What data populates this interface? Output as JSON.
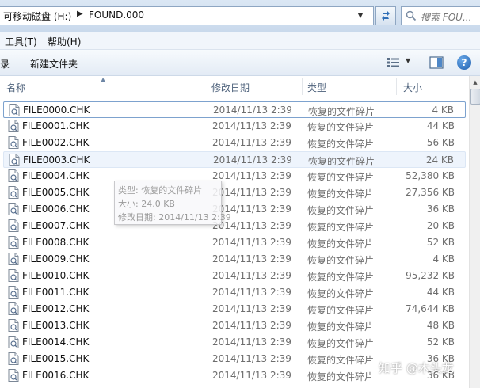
{
  "address": {
    "crumbs": [
      "可移动磁盘 (H:)",
      "FOUND.000"
    ],
    "search_placeholder": "搜索 FOU..."
  },
  "menu": [
    "工具(T)",
    "帮助(H)"
  ],
  "command_bar": {
    "partial_left": "录",
    "new_folder": "新建文件夹"
  },
  "columns": {
    "name": "名称",
    "modified": "修改日期",
    "type": "类型",
    "size": "大小"
  },
  "files": [
    {
      "name": "FILE0000.CHK",
      "date": "2014/11/13 2:39",
      "type": "恢复的文件碎片",
      "size": "4 KB"
    },
    {
      "name": "FILE0001.CHK",
      "date": "2014/11/13 2:39",
      "type": "恢复的文件碎片",
      "size": "44 KB"
    },
    {
      "name": "FILE0002.CHK",
      "date": "2014/11/13 2:39",
      "type": "恢复的文件碎片",
      "size": "56 KB"
    },
    {
      "name": "FILE0003.CHK",
      "date": "2014/11/13 2:39",
      "type": "恢复的文件碎片",
      "size": "24 KB"
    },
    {
      "name": "FILE0004.CHK",
      "date": "2014/11/13 2:39",
      "type": "恢复的文件碎片",
      "size": "52,380 KB"
    },
    {
      "name": "FILE0005.CHK",
      "date": "2014/11/13 2:39",
      "type": "恢复的文件碎片",
      "size": "27,356 KB"
    },
    {
      "name": "FILE0006.CHK",
      "date": "2014/11/13 2:39",
      "type": "恢复的文件碎片",
      "size": "36 KB"
    },
    {
      "name": "FILE0007.CHK",
      "date": "2014/11/13 2:39",
      "type": "恢复的文件碎片",
      "size": "20 KB"
    },
    {
      "name": "FILE0008.CHK",
      "date": "2014/11/13 2:39",
      "type": "恢复的文件碎片",
      "size": "52 KB"
    },
    {
      "name": "FILE0009.CHK",
      "date": "2014/11/13 2:39",
      "type": "恢复的文件碎片",
      "size": "4 KB"
    },
    {
      "name": "FILE0010.CHK",
      "date": "2014/11/13 2:39",
      "type": "恢复的文件碎片",
      "size": "95,232 KB"
    },
    {
      "name": "FILE0011.CHK",
      "date": "2014/11/13 2:39",
      "type": "恢复的文件碎片",
      "size": "44 KB"
    },
    {
      "name": "FILE0012.CHK",
      "date": "2014/11/13 2:39",
      "type": "恢复的文件碎片",
      "size": "74,644 KB"
    },
    {
      "name": "FILE0013.CHK",
      "date": "2014/11/13 2:39",
      "type": "恢复的文件碎片",
      "size": "48 KB"
    },
    {
      "name": "FILE0014.CHK",
      "date": "2014/11/13 2:39",
      "type": "恢复的文件碎片",
      "size": "52 KB"
    },
    {
      "name": "FILE0015.CHK",
      "date": "2014/11/13 2:39",
      "type": "恢复的文件碎片",
      "size": "36 KB"
    },
    {
      "name": "FILE0016.CHK",
      "date": "2014/11/13 2:39",
      "type": "恢复的文件碎片",
      "size": "36 KB"
    }
  ],
  "tooltip": {
    "type_line": "类型: 恢复的文件碎片",
    "size_line": "大小: 24.0 KB",
    "date_line": "修改日期: 2014/11/13 2:39"
  },
  "watermark": "知乎 @木头龙",
  "colors": {
    "chrome_top": "#dbe7f4",
    "row_focus_border": "#7da2ce",
    "row_hover": "#eef4fc",
    "header_text": "#4c607a",
    "detail_text": "#6d6d6d"
  }
}
